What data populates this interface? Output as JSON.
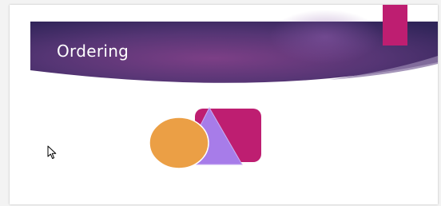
{
  "slide": {
    "title": "Ordering"
  },
  "theme": {
    "banner_dark": "#3b2a63",
    "banner_mid": "#7a3d84",
    "accent_magenta": "#be1e71",
    "orange": "#eb9f45",
    "lavender": "#a77ce9"
  },
  "shapes": [
    {
      "name": "rounded-rectangle",
      "color": "#be1e71"
    },
    {
      "name": "triangle",
      "color": "#a77ce9"
    },
    {
      "name": "ellipse",
      "color": "#eb9f45"
    }
  ]
}
